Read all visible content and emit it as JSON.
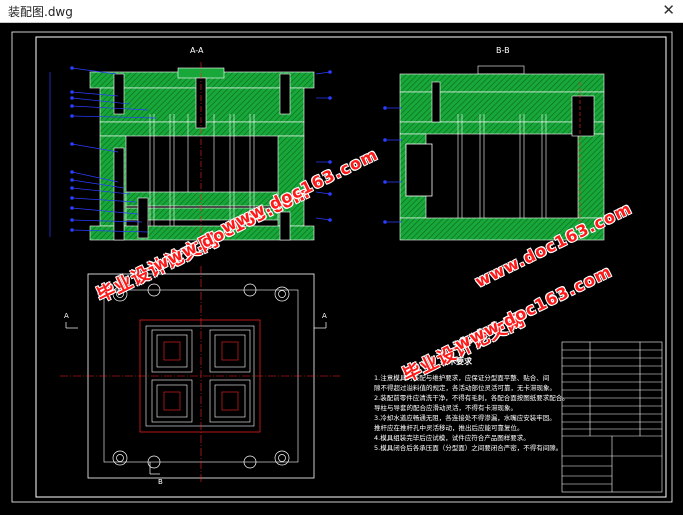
{
  "window": {
    "title": "装配图.dwg",
    "close_glyph": "✕"
  },
  "views": {
    "section_aa": "A-A",
    "section_bb": "B-B",
    "mark_a": "A",
    "mark_b": "B"
  },
  "technical_requirements": {
    "heading": "技术要求",
    "lines": [
      "1.注意模具的装配与维护要求，应保证分型面平整、贴合、间",
      "  隙不得超过溢料值的规定，各活动部位灵活可靠，无卡滞现象。",
      "2.装配前零件应清洗干净，不得有毛刺，各配合面按图纸要求配合。",
      "  导柱与导套的配合应滑动灵活，不得有卡滞现象。",
      "3.冷却水道应畅通无阻，各连接处不得渗漏，水嘴应安装牢固。",
      "  推杆应在推杆孔中灵活移动，推出后应能可靠复位。",
      "4.模具组装完毕后应试模，试件应符合产品图样要求。",
      "5.模具闭合后各承压面（分型面）之间要闭合严密，不得有间隙。"
    ]
  },
  "watermarks": {
    "cn": "毕业设计论文网",
    "url": "www.doc163.com"
  },
  "colors": {
    "background": "#000000",
    "plate_fill": "#18a83a",
    "hatch": "#0b6a1f",
    "outline": "#ffffff",
    "leader": "#2b3dff",
    "centerline": "#ff2020",
    "watermark": "#ff1a1a",
    "frame": "#ffffff"
  }
}
